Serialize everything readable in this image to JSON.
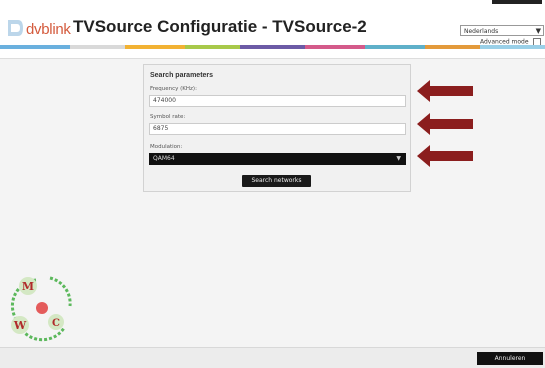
{
  "header": {
    "logo_text": "dvblink",
    "title": "TVSource Configuratie - TVSource-2",
    "language": "Nederlands",
    "advanced_mode_label": "Advanced mode"
  },
  "colors": {
    "stripe": [
      "#6ab0de",
      "#d9d9d9",
      "#f2b233",
      "#a8c94a",
      "#6c5ba6",
      "#d45a8a",
      "#5fb0c9",
      "#e39a3b",
      "#9ad0e8"
    ],
    "brand": "#d45a3c",
    "arrow": "#8b1e1e"
  },
  "panel": {
    "title": "Search parameters",
    "frequency_label": "Frequency (KHz):",
    "frequency_value": "474000",
    "symbol_rate_label": "Symbol rate:",
    "symbol_rate_value": "6875",
    "modulation_label": "Modulation:",
    "modulation_value": "QAM64",
    "search_button": "Search networks"
  },
  "watermark": {
    "letters": [
      "M",
      "W",
      "C"
    ]
  },
  "footer": {
    "cancel_button": "Annuleren"
  }
}
